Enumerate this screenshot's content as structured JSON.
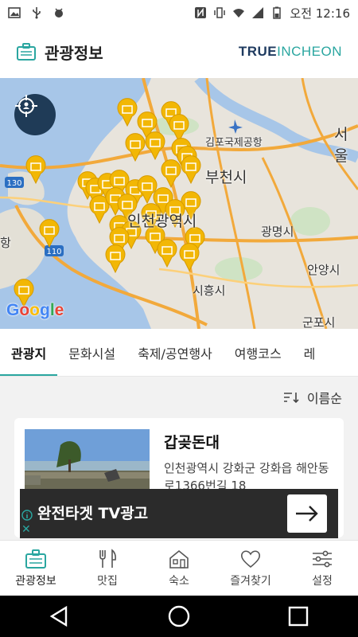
{
  "statusbar": {
    "time": "오전 12:16",
    "icons": [
      "image-icon",
      "usb-icon",
      "android-debug-icon",
      "nfc-icon",
      "vibrate-icon",
      "wifi-icon",
      "signal-icon",
      "battery-icon"
    ]
  },
  "header": {
    "title": "관광정보",
    "icon": "briefcase-icon",
    "brand_bold": "TRUE",
    "brand_light": "INCHEON"
  },
  "map": {
    "labels": [
      "김포국제공항",
      "서울",
      "부천시",
      "인천광역시",
      "광명시",
      "안양시",
      "시흥시",
      "군포시",
      "항",
      "130",
      "110"
    ],
    "provider": "Google",
    "marker_color": "#f2b705"
  },
  "tabs": [
    {
      "label": "관광지",
      "active": true
    },
    {
      "label": "문화시설",
      "active": false
    },
    {
      "label": "축제/공연행사",
      "active": false
    },
    {
      "label": "여행코스",
      "active": false
    },
    {
      "label": "레",
      "active": false
    }
  ],
  "sort": {
    "label": "이름순",
    "icon": "sort-icon"
  },
  "list": [
    {
      "title": "갑곶돈대",
      "address": "인천광역시 강화군 강화읍 해안동로1366번길 18"
    }
  ],
  "ad": {
    "text": "완전타겟 TV광고"
  },
  "bottomnav": [
    {
      "label": "관광정보",
      "icon": "briefcase-icon",
      "active": true
    },
    {
      "label": "맛집",
      "icon": "utensils-icon",
      "active": false
    },
    {
      "label": "숙소",
      "icon": "house-icon",
      "active": false
    },
    {
      "label": "즐겨찾기",
      "icon": "heart-icon",
      "active": false
    },
    {
      "label": "설정",
      "icon": "sliders-icon",
      "active": false
    }
  ],
  "colors": {
    "accent": "#2aa6a0",
    "brand_navy": "#1e3a5f",
    "marker": "#f2b705"
  }
}
